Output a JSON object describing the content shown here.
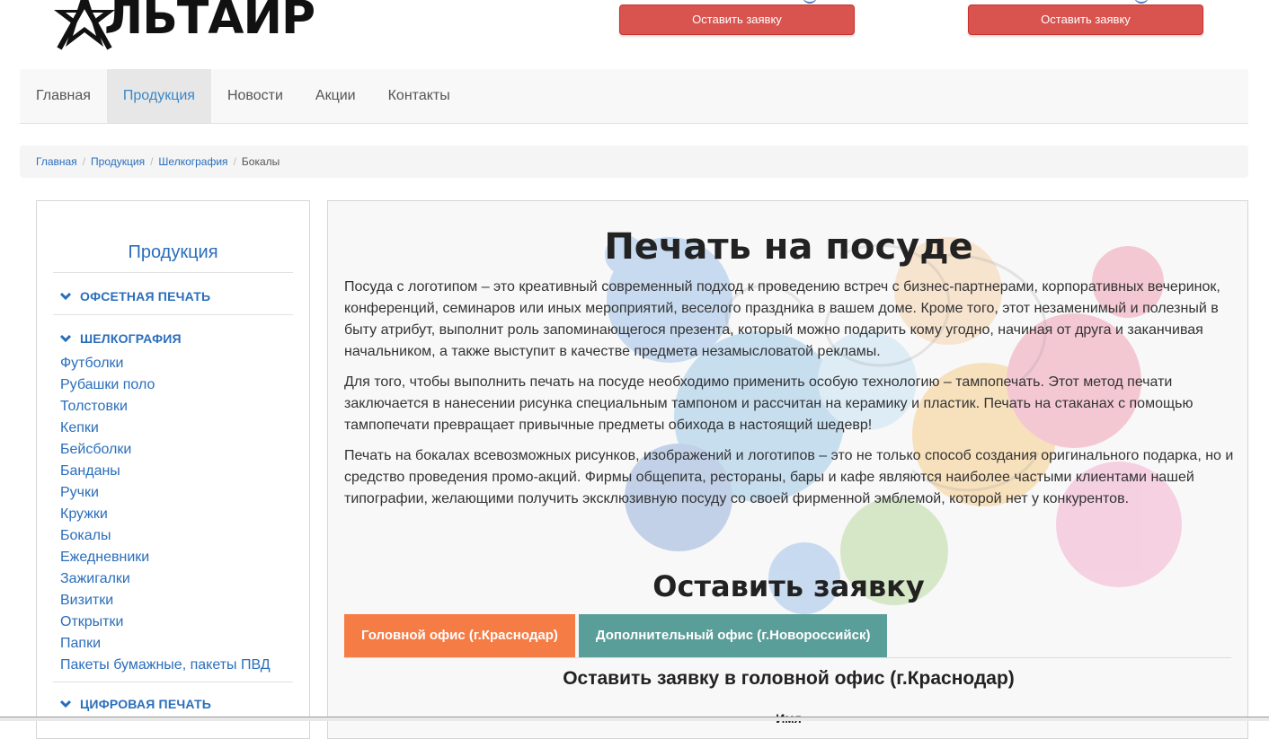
{
  "header": {
    "logo_text": "ЛЬТАИР",
    "request_button_1": "Оставить заявку",
    "request_button_2": "Оставить заявку"
  },
  "nav": {
    "items": [
      {
        "label": "Главная",
        "active": false
      },
      {
        "label": "Продукция",
        "active": true
      },
      {
        "label": "Новости",
        "active": false
      },
      {
        "label": "Акции",
        "active": false
      },
      {
        "label": "Контакты",
        "active": false
      }
    ]
  },
  "breadcrumb": {
    "items": [
      "Главная",
      "Продукция",
      "Шелкография"
    ],
    "current": "Бокалы",
    "separator": "/"
  },
  "sidebar": {
    "title": "Продукция",
    "categories": [
      {
        "label": "ОФСЕТНАЯ ПЕЧАТЬ"
      },
      {
        "label": "ШЕЛКОГРАФИЯ",
        "items": [
          "Футболки",
          "Рубашки поло",
          "Толстовки",
          "Кепки",
          "Бейсболки",
          "Банданы",
          "Ручки",
          "Кружки",
          "Бокалы",
          "Ежедневники",
          "Зажигалки",
          "Визитки",
          "Открытки",
          "Папки",
          "Пакеты бумажные, пакеты ПВД"
        ]
      },
      {
        "label": "ЦИФРОВАЯ ПЕЧАТЬ"
      }
    ]
  },
  "content": {
    "title": "Печать на посуде",
    "paragraphs": [
      "Посуда с логотипом – это креативный современный подход к проведению  встреч с бизнес-партнерами, корпоративных вечеринок, конференций, семинаров или иных мероприятий, веселого праздника в вашем доме. Кроме того, этот незаменимый и полезный в быту атрибут, выполнит роль запоминающегося презента, который можно подарить кому угодно, начиная от друга и заканчивая начальником, а также выступит в качестве предмета незамысловатой рекламы.",
      "Для того, чтобы выполнить печать на посуде необходимо применить особую технологию – тампопечать. Этот метод печати заключается в нанесении рисунка специальным тампоном и рассчитан на керамику и пластик. Печать на стаканах с помощью тампопечати превращает привычные предметы обихода в настоящий шедевр!",
      "Печать на бокалах всевозможных рисунков, изображений и логотипов – это не только способ создания оригинального подарка, но и средство проведения промо-акций. Фирмы общепита, рестораны, бары и кафе являются наиболее частыми клиентами нашей типографии, желающими получить эксклюзивную посуду со своей фирменной эмблемой, которой нет у конкурентов."
    ],
    "request_title": "Оставить заявку",
    "tabs": [
      "Головной офис (г.Краснодар)",
      "Дополнительный офис (г.Новороссийск)"
    ],
    "form_title": "Оставить заявку в головной офис (г.Краснодар)",
    "form_field_label": "Имя"
  },
  "colors": {
    "accent_red": "#d9534f",
    "link_blue": "#2a6ebb",
    "tab_orange": "#f57c45",
    "tab_teal": "#5a9e99"
  }
}
